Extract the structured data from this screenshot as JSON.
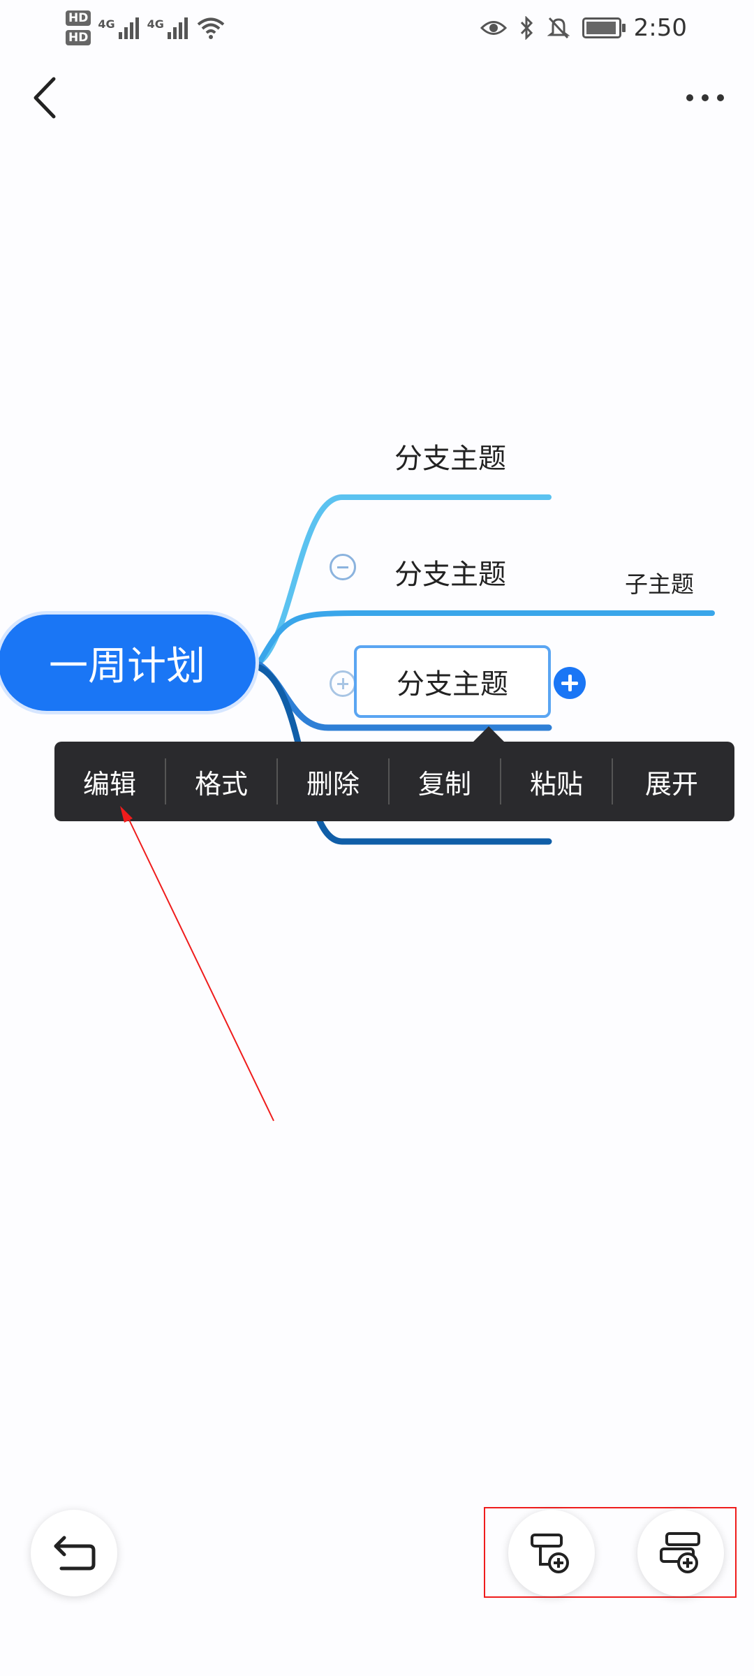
{
  "status_bar": {
    "hd1": "HD",
    "hd2": "HD",
    "net1": "4G",
    "net2": "4G",
    "time": "2:50",
    "icons": [
      "eye-icon",
      "bluetooth-icon",
      "bell-off-icon",
      "battery-icon",
      "wifi-icon",
      "signal-icon"
    ]
  },
  "header": {
    "back_icon": "chevron-left-icon",
    "more_icon": "more-dots-icon"
  },
  "mind_map": {
    "central_topic": "一周计划",
    "branches": [
      {
        "label": "分支主题"
      },
      {
        "label": "分支主题"
      },
      {
        "label": "分支主题",
        "selected": true
      }
    ],
    "sub_topic": "子主题",
    "colors": {
      "central": "#1a76f5",
      "branch1": "#5bc2f0",
      "branch2": "#3aa6ea",
      "branch3": "#2e7fd6",
      "branch4": "#105ea8"
    }
  },
  "context_menu": {
    "items": [
      "编辑",
      "格式",
      "删除",
      "复制",
      "粘贴",
      "展开"
    ]
  },
  "bottom_bar": {
    "undo_icon": "undo-icon",
    "add_subtopic_icon": "add-subtopic-icon",
    "add_topic_icon": "add-topic-icon"
  }
}
